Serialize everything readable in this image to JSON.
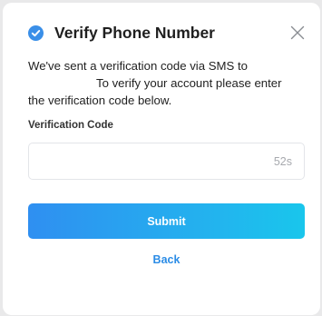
{
  "dialog": {
    "title": "Verify Phone Number",
    "close_icon": "close-icon",
    "check_icon": "check-circle-icon",
    "message_lines": [
      "We've sent a verification code via SMS to",
      "To verify your account please enter",
      "the verification code below."
    ],
    "code_field": {
      "label": "Verification Code",
      "value": "",
      "placeholder": "",
      "countdown": "52s"
    },
    "submit_label": "Submit",
    "back_label": "Back"
  },
  "colors": {
    "accent": "#2b8ce6",
    "button_gradient_start": "#2f8ff1",
    "button_gradient_end": "#19c6ec",
    "check_badge": "#3a8fe8"
  }
}
